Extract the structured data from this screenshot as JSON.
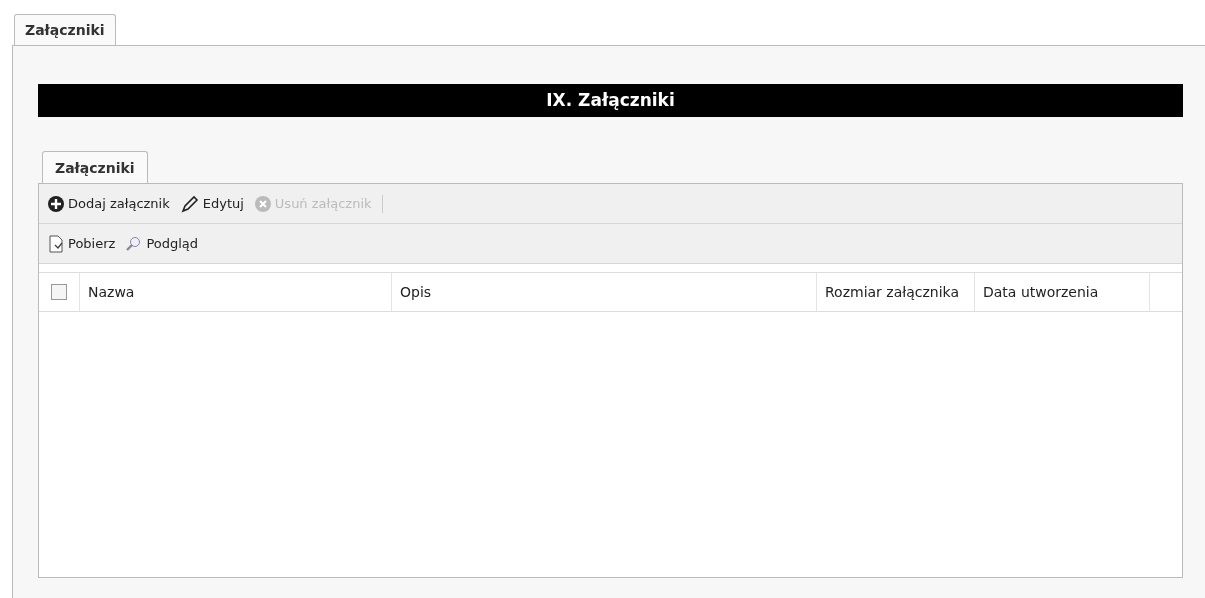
{
  "outer_tabs": [
    {
      "label": "Załączniki",
      "selected": true
    }
  ],
  "section_title": "IX. Załączniki",
  "inner_tabs": [
    {
      "label": "Załączniki",
      "selected": true
    }
  ],
  "toolbar_1": [
    {
      "kind": "add",
      "label": "Dodaj załącznik",
      "disabled": false
    },
    {
      "kind": "edit",
      "label": "Edytuj",
      "disabled": false
    },
    {
      "kind": "delete",
      "label": "Usuń załącznik",
      "disabled": true
    }
  ],
  "toolbar_2": [
    {
      "kind": "download",
      "label": "Pobierz",
      "disabled": false
    },
    {
      "kind": "preview",
      "label": "Podgląd",
      "disabled": false
    }
  ],
  "table": {
    "select_all_checked": false,
    "columns": [
      "Nazwa",
      "Opis",
      "Rozmiar załącznika",
      "Data utworzenia"
    ]
  }
}
